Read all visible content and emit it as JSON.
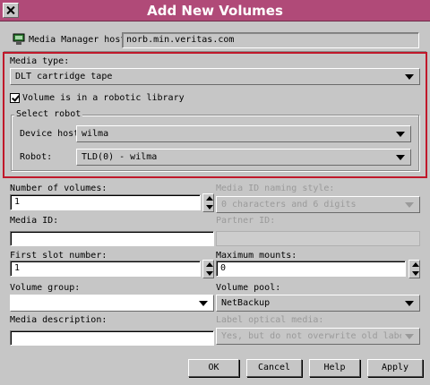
{
  "window": {
    "title": "Add New Volumes"
  },
  "host": {
    "label": "Media Manager host:",
    "value": "norb.min.veritas.com"
  },
  "media_type": {
    "label": "Media type:",
    "value": "DLT cartridge tape"
  },
  "robotic": {
    "label": "Volume is in a robotic library",
    "checked": true
  },
  "select_robot": {
    "title": "Select robot",
    "device_host_label": "Device host:",
    "device_host_value": "wilma",
    "robot_label": "Robot:",
    "robot_value": "TLD(0) - wilma"
  },
  "volumes_count": {
    "label": "Number of volumes:",
    "value": "1"
  },
  "media_id_style": {
    "label": "Media ID naming style:",
    "value": "0 characters and 6 digits"
  },
  "media_id": {
    "label": "Media ID:",
    "value": ""
  },
  "partner_id": {
    "label": "Partner ID:",
    "value": ""
  },
  "first_slot": {
    "label": "First slot number:",
    "value": "1"
  },
  "max_mounts": {
    "label": "Maximum mounts:",
    "value": "0"
  },
  "volume_group": {
    "label": "Volume group:",
    "value": ""
  },
  "volume_pool": {
    "label": "Volume pool:",
    "value": "NetBackup"
  },
  "media_description": {
    "label": "Media description:",
    "value": ""
  },
  "label_optical": {
    "label": "Label optical media:",
    "value": "Yes, but do not overwrite old labels"
  },
  "buttons": {
    "ok": "OK",
    "cancel": "Cancel",
    "help": "Help",
    "apply": "Apply"
  },
  "colors": {
    "title_bar": "#b04a78",
    "highlight_border": "#c0182a",
    "dialog_bg": "#c6c6c6"
  },
  "icons": {
    "close": "close-icon",
    "host": "computer-icon"
  }
}
